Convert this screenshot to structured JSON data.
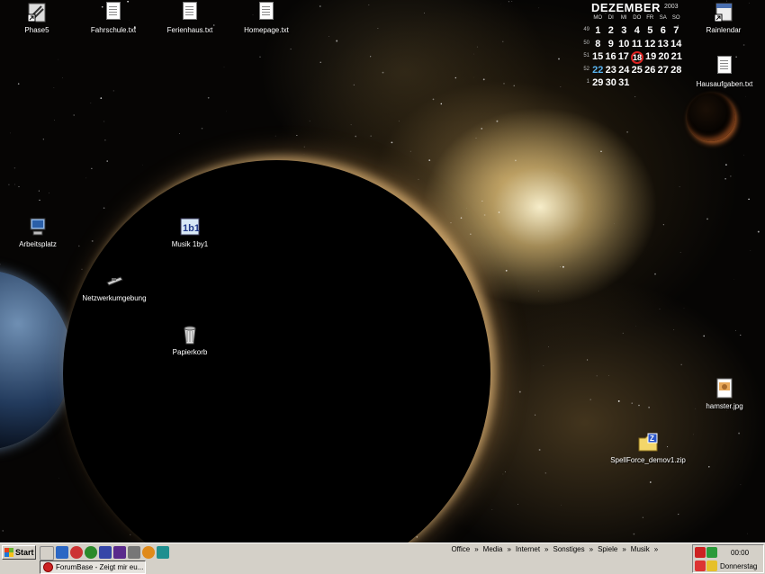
{
  "desktop": {
    "icons": [
      {
        "name": "phase5-icon",
        "label": "Phase5"
      },
      {
        "name": "fahrschule-icon",
        "label": "Fahrschule.txt"
      },
      {
        "name": "ferienhaus-icon",
        "label": "Ferienhaus.txt"
      },
      {
        "name": "homepage-icon",
        "label": "Homepage.txt"
      },
      {
        "name": "rainlendar-icon",
        "label": "Rainlendar"
      },
      {
        "name": "hausaufgaben-icon",
        "label": "Hausaufgaben.txt"
      },
      {
        "name": "arbeitsplatz-icon",
        "label": "Arbeitsplatz"
      },
      {
        "name": "musik-icon",
        "label": "Musik 1by1"
      },
      {
        "name": "netzwerk-icon",
        "label": "Netzwerkumgebung"
      },
      {
        "name": "papierkorb-icon",
        "label": "Papierkorb"
      },
      {
        "name": "hamster-icon",
        "label": "hamster.jpg"
      },
      {
        "name": "spellforce-icon",
        "label": "SpellForce_demov1.zip"
      }
    ]
  },
  "calendar": {
    "month": "DEZEMBER",
    "year": "2003",
    "weekdays": [
      "MO",
      "DI",
      "MI",
      "DO",
      "FR",
      "SA",
      "SO"
    ],
    "weeks": [
      "49",
      "50",
      "51",
      "52",
      "1"
    ],
    "rows": [
      [
        "1",
        "2",
        "3",
        "4",
        "5",
        "6",
        "7"
      ],
      [
        "8",
        "9",
        "10",
        "11",
        "12",
        "13",
        "14"
      ],
      [
        "15",
        "16",
        "17",
        "18",
        "19",
        "20",
        "21"
      ],
      [
        "22",
        "23",
        "24",
        "25",
        "26",
        "27",
        "28"
      ],
      [
        "29",
        "30",
        "31",
        "",
        "",
        "",
        ""
      ]
    ],
    "today": "18",
    "highlight": "22",
    "today_color": "#dd2222",
    "highlight_color": "#5ab4f0"
  },
  "taskbar": {
    "start_label": "Start",
    "task_label": "ForumBase - Zeigt mir eu...",
    "menus": [
      "Office",
      "Media",
      "Internet",
      "Sonstiges",
      "Spiele",
      "Musik"
    ],
    "menu_separator": "»",
    "clock": "00:00",
    "day": "Donnerstag"
  }
}
